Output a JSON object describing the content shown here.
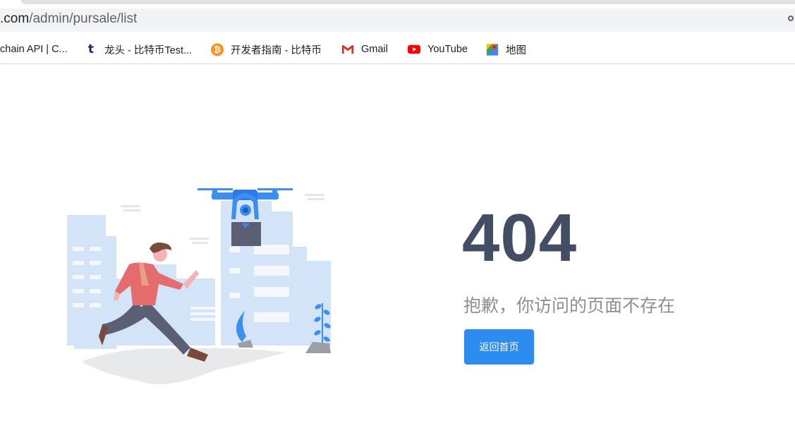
{
  "browser": {
    "url_host_partial": ".com",
    "url_path": "/admin/pursale/list",
    "bookmarks": [
      {
        "label": "chain API | C...",
        "icon": "blockchain-icon"
      },
      {
        "label": "龙头 - 比特币Test...",
        "icon": "t-logo-icon"
      },
      {
        "label": "开发者指南 - 比特币",
        "icon": "bitcoin-icon"
      },
      {
        "label": "Gmail",
        "icon": "gmail-icon"
      },
      {
        "label": "YouTube",
        "icon": "youtube-icon"
      },
      {
        "label": "地图",
        "icon": "maps-icon"
      }
    ]
  },
  "page": {
    "error_code": "404",
    "message": "抱歉，你访问的页面不存在",
    "home_button_label": "返回首页"
  },
  "colors": {
    "primary": "#2d8cf0",
    "code_text": "#434e65",
    "message_text": "#8a8f99",
    "illustration_buildings": "#d3e3f8",
    "illustration_drone": "#3b8ef2"
  }
}
